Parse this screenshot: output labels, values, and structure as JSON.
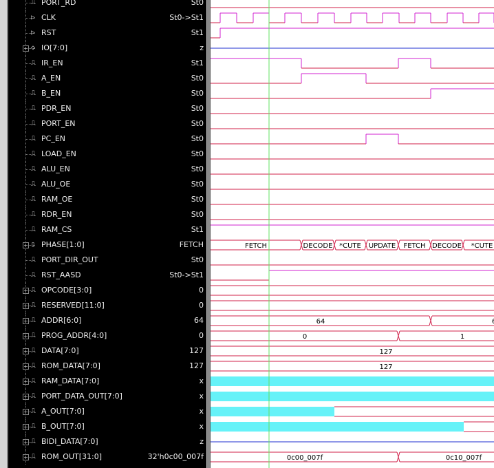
{
  "signals": [
    {
      "name": "PORT_RD",
      "value": "St0",
      "icon": "logic-icon",
      "expandable": false,
      "wave": "bit",
      "color": "#d0204a"
    },
    {
      "name": "CLK",
      "value": "St0->St1",
      "icon": "input-icon",
      "expandable": false,
      "wave": "bit",
      "color": "#d0204a"
    },
    {
      "name": "RST",
      "value": "St1",
      "icon": "input-icon",
      "expandable": false,
      "wave": "bit",
      "color": "#d0204a"
    },
    {
      "name": "IO[7:0]",
      "value": "z",
      "icon": "inout-icon",
      "expandable": true,
      "wave": "z",
      "color": "#2030d0"
    },
    {
      "name": "IR_EN",
      "value": "St1",
      "icon": "logic-icon",
      "expandable": false,
      "wave": "bit",
      "color": "#d0204a"
    },
    {
      "name": "A_EN",
      "value": "St0",
      "icon": "logic-icon",
      "expandable": false,
      "wave": "bit",
      "color": "#d0204a"
    },
    {
      "name": "B_EN",
      "value": "St0",
      "icon": "logic-icon",
      "expandable": false,
      "wave": "bit",
      "color": "#d0204a"
    },
    {
      "name": "PDR_EN",
      "value": "St0",
      "icon": "logic-icon",
      "expandable": false,
      "wave": "bit",
      "color": "#d0204a"
    },
    {
      "name": "PORT_EN",
      "value": "St0",
      "icon": "logic-icon",
      "expandable": false,
      "wave": "bit",
      "color": "#d0204a"
    },
    {
      "name": "PC_EN",
      "value": "St0",
      "icon": "logic-icon",
      "expandable": false,
      "wave": "bit",
      "color": "#d0204a"
    },
    {
      "name": "LOAD_EN",
      "value": "St0",
      "icon": "logic-icon",
      "expandable": false,
      "wave": "bit",
      "color": "#d0204a"
    },
    {
      "name": "ALU_EN",
      "value": "St0",
      "icon": "logic-icon",
      "expandable": false,
      "wave": "bit",
      "color": "#d0204a"
    },
    {
      "name": "ALU_OE",
      "value": "St0",
      "icon": "logic-icon",
      "expandable": false,
      "wave": "bit",
      "color": "#d0204a"
    },
    {
      "name": "RAM_OE",
      "value": "St0",
      "icon": "logic-icon",
      "expandable": false,
      "wave": "bit",
      "color": "#d0204a"
    },
    {
      "name": "RDR_EN",
      "value": "St0",
      "icon": "logic-icon",
      "expandable": false,
      "wave": "bit",
      "color": "#d0204a"
    },
    {
      "name": "RAM_CS",
      "value": "St1",
      "icon": "logic-icon",
      "expandable": false,
      "wave": "bit",
      "color": "#d0204a"
    },
    {
      "name": "PHASE[1:0]",
      "value": "FETCH",
      "icon": "enum-icon",
      "expandable": true,
      "wave": "bus",
      "color": "#d0204a"
    },
    {
      "name": "PORT_DIR_OUT",
      "value": "St0",
      "icon": "logic-icon",
      "expandable": false,
      "wave": "bit",
      "color": "#d0204a"
    },
    {
      "name": "RST_AASD",
      "value": "St0->St1",
      "icon": "logic-icon",
      "expandable": false,
      "wave": "bit",
      "color": "#d0204a"
    },
    {
      "name": "OPCODE[3:0]",
      "value": "0",
      "icon": "logic-icon",
      "expandable": true,
      "wave": "bus",
      "color": "#d0204a"
    },
    {
      "name": "RESERVED[11:0]",
      "value": "0",
      "icon": "logic-icon",
      "expandable": true,
      "wave": "bus",
      "color": "#d0204a"
    },
    {
      "name": "ADDR[6:0]",
      "value": "64",
      "icon": "logic-icon",
      "expandable": true,
      "wave": "bus",
      "color": "#d0204a"
    },
    {
      "name": "PROG_ADDR[4:0]",
      "value": "0",
      "icon": "logic-icon",
      "expandable": true,
      "wave": "bus",
      "color": "#d0204a"
    },
    {
      "name": "DATA[7:0]",
      "value": "127",
      "icon": "logic-icon",
      "expandable": true,
      "wave": "bus",
      "color": "#d0204a"
    },
    {
      "name": "ROM_DATA[7:0]",
      "value": "127",
      "icon": "logic-icon",
      "expandable": true,
      "wave": "bus",
      "color": "#d0204a"
    },
    {
      "name": "RAM_DATA[7:0]",
      "value": "x",
      "icon": "logic-icon",
      "expandable": true,
      "wave": "x",
      "color": "#d0204a"
    },
    {
      "name": "PORT_DATA_OUT[7:0]",
      "value": "x",
      "icon": "logic-icon",
      "expandable": true,
      "wave": "x",
      "color": "#d0204a"
    },
    {
      "name": "A_OUT[7:0]",
      "value": "x",
      "icon": "logic-icon",
      "expandable": true,
      "wave": "x",
      "color": "#d0204a"
    },
    {
      "name": "B_OUT[7:0]",
      "value": "x",
      "icon": "logic-icon",
      "expandable": true,
      "wave": "x",
      "color": "#d0204a"
    },
    {
      "name": "BIDI_DATA[7:0]",
      "value": "z",
      "icon": "logic-icon",
      "expandable": true,
      "wave": "z",
      "color": "#2030d0"
    },
    {
      "name": "ROM_OUT[31:0]",
      "value": "32'h0c00_007f",
      "icon": "logic-icon",
      "expandable": true,
      "wave": "bus",
      "color": "#d0204a"
    }
  ],
  "wave_labels": {
    "phase": [
      "FETCH",
      "DECODE",
      "*CUTE",
      "UPDATE",
      "FETCH",
      "DECODE",
      "*CUTE"
    ],
    "addr": [
      "64",
      "6"
    ],
    "prog_addr": [
      "0",
      "1"
    ],
    "data": "127",
    "rom_data": "127",
    "rom_out": [
      "0c00_007f",
      "0c10_007f"
    ]
  },
  "colors": {
    "high_level": "#d020d0",
    "low_level": "#d0204a",
    "hiz": "#2030d0",
    "unknown_fill": "#66f2f8",
    "cursor": "#60e060",
    "background_names": "#000000",
    "background_wave": "#ffffff"
  }
}
